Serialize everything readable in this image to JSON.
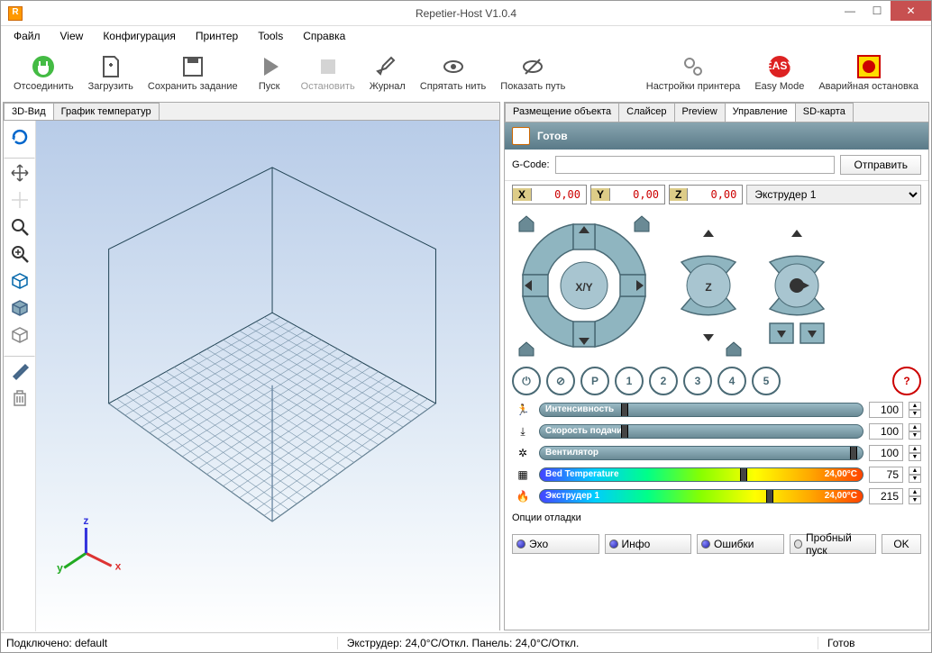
{
  "window": {
    "title": "Repetier-Host V1.0.4"
  },
  "menu": [
    "Файл",
    "View",
    "Конфигурация",
    "Принтер",
    "Tools",
    "Справка"
  ],
  "toolbar": {
    "disconnect": "Отсоединить",
    "load": "Загрузить",
    "save_job": "Сохранить задание",
    "run": "Пуск",
    "stop": "Остановить",
    "log": "Журнал",
    "hide_filament": "Спрятать нить",
    "show_travel": "Показать путь",
    "printer_settings": "Настройки принтера",
    "easy_mode": "Easy Mode",
    "emergency_stop": "Аварийная остановка"
  },
  "left_tabs": {
    "view3d": "3D-Вид",
    "temp_graph": "График температур"
  },
  "right_tabs": {
    "object_placement": "Размещение объекта",
    "slicer": "Слайсер",
    "preview": "Preview",
    "manual": "Управление",
    "sdcard": "SD-карта"
  },
  "control": {
    "status": "Готов",
    "gcode_label": "G-Code:",
    "send": "Отправить",
    "coords": {
      "x_label": "X",
      "x": "0,00",
      "y_label": "Y",
      "y": "0,00",
      "z_label": "Z",
      "z": "0,00"
    },
    "extruder_label": "Экструдер 1",
    "xy_label": "X/Y",
    "z_label": "Z",
    "quick_row": [
      "⏻",
      "⊘",
      "P",
      "1",
      "2",
      "3",
      "4",
      "5",
      "?"
    ],
    "sliders": {
      "speed_label": "Интенсивность",
      "speed_val": "100",
      "feed_label": "Скорость подачи",
      "feed_val": "100",
      "fan_label": "Вентилятор",
      "fan_val": "100",
      "bed_label": "Bed Temperature",
      "bed_rlabel": "24,00°C",
      "bed_val": "75",
      "ext_label": "Экструдер 1",
      "ext_rlabel": "24,00°C",
      "ext_val": "215"
    },
    "debug": {
      "title": "Опции отладки",
      "echo": "Эхо",
      "info": "Инфо",
      "errors": "Ошибки",
      "dry": "Пробный пуск",
      "ok": "OK"
    }
  },
  "statusbar": {
    "connected": "Подключено: default",
    "temps": "Экструдер: 24,0°C/Откл. Панель: 24,0°C/Откл.",
    "ready": "Готов"
  }
}
